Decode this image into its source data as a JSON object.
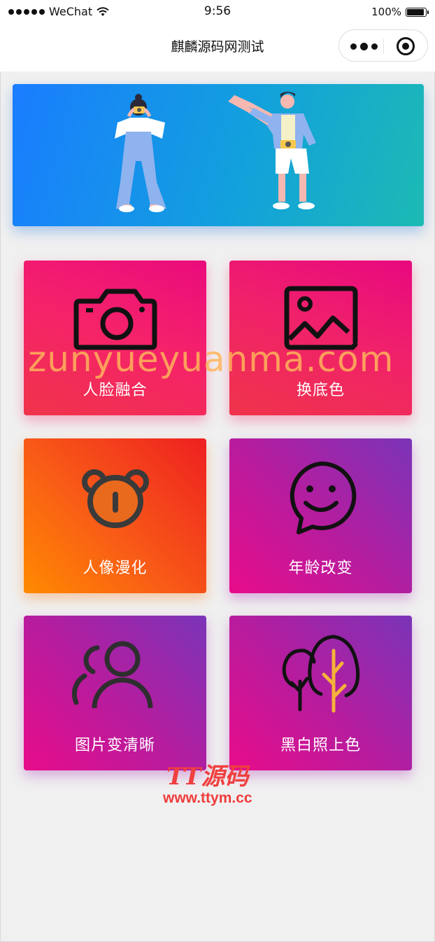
{
  "status_bar": {
    "carrier": "WeChat",
    "time": "9:56",
    "battery": "100%",
    "battery_level": 1.0
  },
  "nav": {
    "title": "麒麟源码网测试"
  },
  "banner": {
    "illustration": "two-people-with-cameras"
  },
  "features": [
    {
      "label": "人脸融合",
      "icon": "camera-icon"
    },
    {
      "label": "换底色",
      "icon": "image-icon"
    },
    {
      "label": "人像漫化",
      "icon": "bear-face-icon"
    },
    {
      "label": "年龄改变",
      "icon": "smiley-chat-icon"
    },
    {
      "label": "图片变清晰",
      "icon": "users-icon"
    },
    {
      "label": "黑白照上色",
      "icon": "trees-icon"
    }
  ],
  "watermarks": {
    "overlay": "zunyueyuanma.com",
    "logo_text": "TT源码",
    "logo_url": "www.ttym.cc"
  }
}
